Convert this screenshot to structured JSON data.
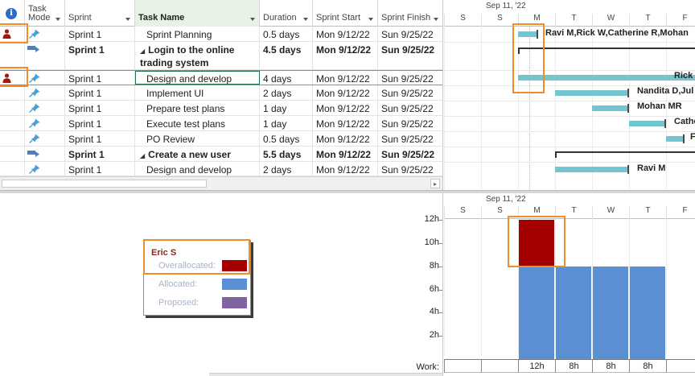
{
  "grid": {
    "headers": {
      "info_icon": "info-icon",
      "task_mode": "Task\nMode",
      "resource": "Sprint",
      "task_name": "Task Name",
      "duration": "Duration",
      "start": "Sprint Start",
      "finish": "Sprint Finish"
    },
    "rows": [
      {
        "indicator": "person",
        "mode": "manual",
        "resource": "Sprint 1",
        "name": "Sprint Planning",
        "duration": "0.5 days",
        "start": "Mon 9/12/22",
        "finish": "Sun 9/25/22",
        "bold": false
      },
      {
        "indicator": "",
        "mode": "auto",
        "resource": "Sprint 1",
        "name": "Login to the online trading system",
        "duration": "4.5 days",
        "start": "Mon 9/12/22",
        "finish": "Sun 9/25/22",
        "bold": true
      },
      {
        "indicator": "person",
        "mode": "manual",
        "resource": "Sprint 1",
        "name": "Design and develop",
        "duration": "4 days",
        "start": "Mon 9/12/22",
        "finish": "Sun 9/25/22",
        "bold": false
      },
      {
        "indicator": "",
        "mode": "manual",
        "resource": "Sprint 1",
        "name": "Implement UI",
        "duration": "2 days",
        "start": "Mon 9/12/22",
        "finish": "Sun 9/25/22",
        "bold": false
      },
      {
        "indicator": "",
        "mode": "manual",
        "resource": "Sprint 1",
        "name": "Prepare test plans",
        "duration": "1 day",
        "start": "Mon 9/12/22",
        "finish": "Sun 9/25/22",
        "bold": false
      },
      {
        "indicator": "",
        "mode": "manual",
        "resource": "Sprint 1",
        "name": "Execute test plans",
        "duration": "1 day",
        "start": "Mon 9/12/22",
        "finish": "Sun 9/25/22",
        "bold": false
      },
      {
        "indicator": "",
        "mode": "manual",
        "resource": "Sprint 1",
        "name": "PO Review",
        "duration": "0.5 days",
        "start": "Mon 9/12/22",
        "finish": "Sun 9/25/22",
        "bold": false
      },
      {
        "indicator": "",
        "mode": "auto",
        "resource": "Sprint 1",
        "name": "Create a new user",
        "duration": "5.5 days",
        "start": "Mon 9/12/22",
        "finish": "Sun 9/25/22",
        "bold": true
      },
      {
        "indicator": "",
        "mode": "manual",
        "resource": "Sprint 1",
        "name": "Design and develop",
        "duration": "2 days",
        "start": "Mon 9/12/22",
        "finish": "Sun 9/25/22",
        "bold": false
      }
    ]
  },
  "timeline": {
    "week": "Sep 11, '22",
    "days": [
      "S",
      "S",
      "M",
      "T",
      "W",
      "T",
      "F"
    ]
  },
  "gantt_labels": {
    "row1": "Ravi M,Rick W,Catherine R,Mohan",
    "row3": "Rick V",
    "row4": "Nandita D,Jul",
    "row5": "Mohan MR",
    "row6": "Cathe",
    "row7": "F",
    "row9": "Ravi M"
  },
  "legend": {
    "resource_name": "Eric S",
    "overallocated_label": "Overallocated:",
    "allocated_label": "Allocated:",
    "proposed_label": "Proposed:",
    "colors": {
      "overallocated": "#a50000",
      "allocated": "#5b8fd4",
      "proposed": "#8064a2"
    }
  },
  "usage": {
    "week": "Sep 11, '22",
    "days": [
      "S",
      "S",
      "M",
      "T",
      "W",
      "T",
      "F"
    ],
    "y_ticks": [
      "12h",
      "10h",
      "8h",
      "6h",
      "4h",
      "2h"
    ],
    "work_label": "Work:",
    "work_values": [
      "12h",
      "8h",
      "8h",
      "8h"
    ]
  },
  "chart_data": {
    "type": "bar",
    "categories": [
      "M",
      "T",
      "W",
      "T"
    ],
    "series": [
      {
        "name": "Allocated",
        "values": [
          8,
          8,
          8,
          8
        ]
      },
      {
        "name": "Overallocated",
        "values": [
          4,
          0,
          0,
          0
        ]
      }
    ],
    "ylim": [
      0,
      12
    ],
    "yticks": [
      "2h",
      "4h",
      "6h",
      "8h",
      "10h",
      "12h"
    ]
  }
}
